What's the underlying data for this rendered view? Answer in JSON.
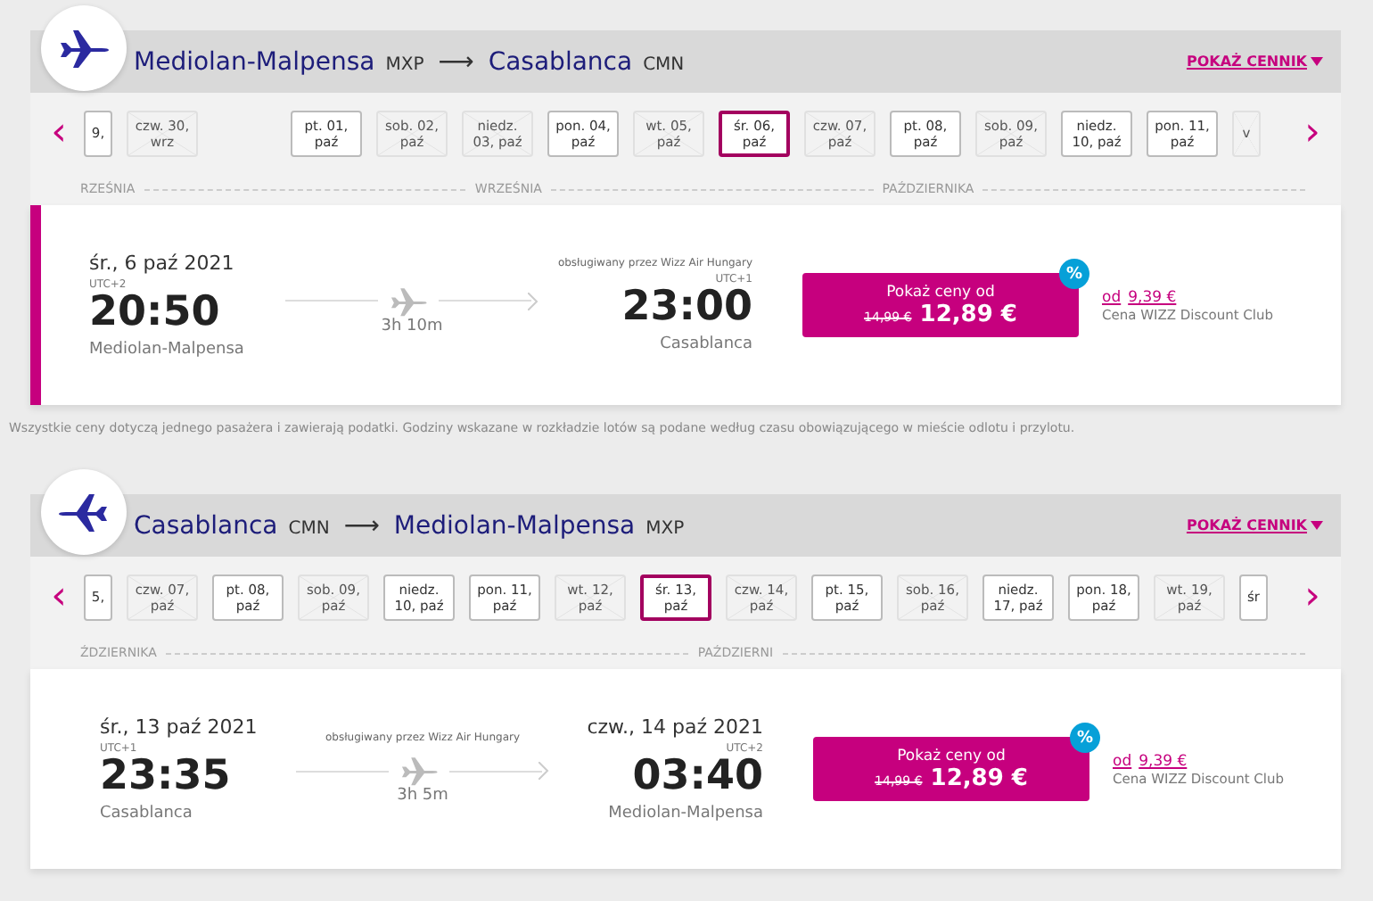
{
  "footnote": "Wszystkie ceny dotyczą jednego pasażera i zawierają podatki. Godziny wskazane w rozkładzie lotów są podane według czasu obowiązującego w mieście odlotu i przylotu.",
  "sections": [
    {
      "from_city": "Mediolan-Malpensa",
      "from_code": "MXP",
      "arrow": "⟶",
      "to_city": "Casablanca",
      "to_code": "CMN",
      "price_list_link": "POKAŻ CENNIK",
      "prev": "‹",
      "next": "›",
      "date_groups": [
        [
          {
            "line1": "9,",
            "available": true,
            "selected": false
          },
          {
            "line1": "czw. 30,",
            "line2": "wrz",
            "available": false,
            "selected": false
          }
        ],
        [
          {
            "line1": "pt. 01,",
            "line2": "paź",
            "available": true,
            "selected": false
          },
          {
            "line1": "sob. 02,",
            "line2": "paź",
            "available": false,
            "selected": false
          },
          {
            "line1": "niedz.",
            "line2": "03, paź",
            "available": false,
            "selected": false
          },
          {
            "line1": "pon. 04,",
            "line2": "paź",
            "available": true,
            "selected": false
          },
          {
            "line1": "wt. 05,",
            "line2": "paź",
            "available": false,
            "selected": false
          },
          {
            "line1": "śr. 06,",
            "line2": "paź",
            "available": true,
            "selected": true
          },
          {
            "line1": "czw. 07,",
            "line2": "paź",
            "available": false,
            "selected": false
          },
          {
            "line1": "pt. 08,",
            "line2": "paź",
            "available": true,
            "selected": false
          },
          {
            "line1": "sob. 09,",
            "line2": "paź",
            "available": false,
            "selected": false
          },
          {
            "line1": "niedz.",
            "line2": "10, paź",
            "available": true,
            "selected": false
          },
          {
            "line1": "pon. 11,",
            "line2": "paź",
            "available": true,
            "selected": false
          },
          {
            "line1": "v",
            "available": false,
            "selected": false
          }
        ]
      ],
      "months": [
        "RZEŚNIA",
        "WRZEŚNIA",
        "PAŹDZIERNIKA"
      ],
      "flight": {
        "selected": true,
        "dep_date": "śr., 6 paź 2021",
        "dep_tz": "UTC+2",
        "dep_time": "20:50",
        "dep_city": "Mediolan-Malpensa",
        "duration": "3h 10m",
        "operator": "obsługiwany przez Wizz Air Hungary",
        "arr_tz": "UTC+1",
        "arr_time": "23:00",
        "arr_city": "Casablanca",
        "price_label": "Pokaż ceny od",
        "old_price": "14,99 €",
        "price": "12,89 €",
        "badge": "%",
        "club_prefix": "od",
        "club_price": "9,39 €",
        "club_label": "Cena WIZZ Discount Club"
      }
    },
    {
      "from_city": "Casablanca",
      "from_code": "CMN",
      "arrow": "⟶",
      "to_city": "Mediolan-Malpensa",
      "to_code": "MXP",
      "price_list_link": "POKAŻ CENNIK",
      "prev": "‹",
      "next": "›",
      "date_groups": [
        [
          {
            "line1": "5,",
            "available": true,
            "selected": false
          },
          {
            "line1": "czw. 07,",
            "line2": "paź",
            "available": false,
            "selected": false
          },
          {
            "line1": "pt. 08,",
            "line2": "paź",
            "available": true,
            "selected": false
          },
          {
            "line1": "sob. 09,",
            "line2": "paź",
            "available": false,
            "selected": false
          },
          {
            "line1": "niedz.",
            "line2": "10, paź",
            "available": true,
            "selected": false
          },
          {
            "line1": "pon. 11,",
            "line2": "paź",
            "available": true,
            "selected": false
          },
          {
            "line1": "wt. 12,",
            "line2": "paź",
            "available": false,
            "selected": false
          },
          {
            "line1": "śr. 13,",
            "line2": "paź",
            "available": true,
            "selected": true
          },
          {
            "line1": "czw. 14,",
            "line2": "paź",
            "available": false,
            "selected": false
          },
          {
            "line1": "pt. 15,",
            "line2": "paź",
            "available": true,
            "selected": false
          },
          {
            "line1": "sob. 16,",
            "line2": "paź",
            "available": false,
            "selected": false
          },
          {
            "line1": "niedz.",
            "line2": "17, paź",
            "available": true,
            "selected": false
          },
          {
            "line1": "pon. 18,",
            "line2": "paź",
            "available": true,
            "selected": false
          },
          {
            "line1": "wt. 19,",
            "line2": "paź",
            "available": false,
            "selected": false
          },
          {
            "line1": "śr",
            "available": true,
            "selected": false
          }
        ]
      ],
      "months": [
        "ŹDZIERNIKA",
        "PAŹDZIERNI"
      ],
      "flight": {
        "selected": false,
        "dep_date": "śr., 13 paź 2021",
        "dep_tz": "UTC+1",
        "dep_time": "23:35",
        "dep_city": "Casablanca",
        "duration": "3h 5m",
        "operator": "obsługiwany przez Wizz Air Hungary",
        "arr_date": "czw., 14 paź 2021",
        "arr_tz": "UTC+2",
        "arr_time": "03:40",
        "arr_city": "Mediolan-Malpensa",
        "price_label": "Pokaż ceny od",
        "old_price": "14,99 €",
        "price": "12,89 €",
        "badge": "%",
        "club_prefix": "od",
        "club_price": "9,39 €",
        "club_label": "Cena WIZZ Discount Club"
      }
    }
  ]
}
